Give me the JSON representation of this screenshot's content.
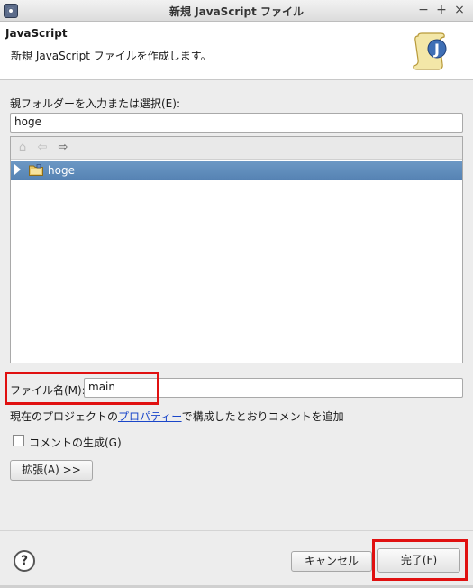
{
  "window": {
    "title": "新規 JavaScript ファイル",
    "controls": {
      "minimize": "−",
      "maximize": "+",
      "close": "×"
    }
  },
  "header": {
    "title": "JavaScript",
    "description": "新規 JavaScript ファイルを作成します。",
    "icon": "javascript-file-wizard-icon"
  },
  "folder": {
    "label": "親フォルダーを入力または選択(E):",
    "value": "hoge"
  },
  "tree": {
    "nav_icons": [
      "home-icon",
      "back-arrow-icon",
      "forward-arrow-icon"
    ],
    "items": [
      {
        "label": "hoge",
        "icon": "project-folder-icon",
        "selected": true,
        "expanded": false
      }
    ]
  },
  "filename": {
    "label": "ファイル名(M):",
    "value": "main"
  },
  "comment_info": {
    "prefix": "現在のプロジェクトの",
    "link": "プロパティー",
    "suffix": "で構成したとおりコメントを追加"
  },
  "comment_checkbox": {
    "label": "コメントの生成(G)",
    "checked": false
  },
  "buttons": {
    "advanced": "拡張(A) >>",
    "help": "?",
    "cancel": "キャンセル",
    "finish": "完了(F)"
  },
  "colors": {
    "highlight": "#e01010",
    "selection": "#5f8dbe",
    "link": "#1a46c9"
  }
}
